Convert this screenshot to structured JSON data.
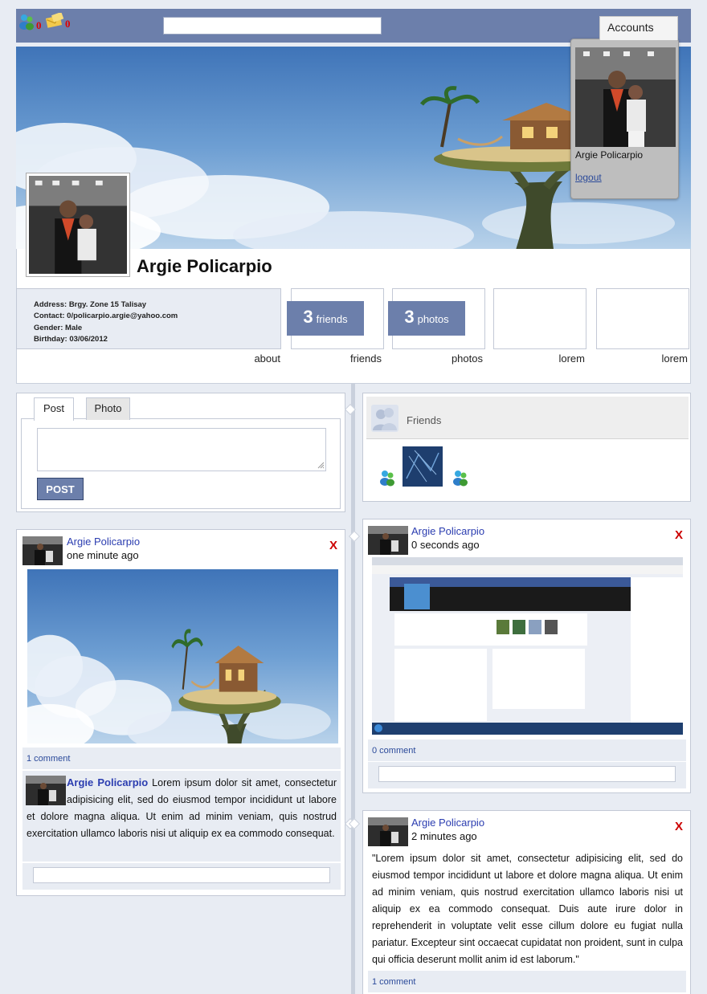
{
  "topbar": {
    "friend_requests_count": "0",
    "messages_count": "0",
    "search_value": ""
  },
  "accounts": {
    "tab_label": "Accounts",
    "user_name": "Argie Policarpio",
    "logout_label": "logout"
  },
  "profile": {
    "name": "Argie Policarpio",
    "address": "Address: Brgy. Zone 15 Talisay",
    "contact": "Contact: 0/policarpio.argie@yahoo.com",
    "gender": "Gender: Male",
    "birthday": "Birthday: 03/06/2012",
    "friends_count": "3",
    "friends_word": "friends",
    "photos_count": "3",
    "photos_word": "photos",
    "tab_labels": [
      "about",
      "friends",
      "photos",
      "lorem",
      "lorem"
    ]
  },
  "composer": {
    "tab_post": "Post",
    "tab_photo": "Photo",
    "post_button": "POST",
    "textarea_value": ""
  },
  "friends_widget": {
    "title": "Friends"
  },
  "feed": {
    "left_post": {
      "author": "Argie Policarpio",
      "time": "one minute ago",
      "delete_label": "X",
      "comment_count": "1 comment",
      "comment": {
        "author": "Argie Policarpio",
        "text": " Lorem ipsum dolor sit amet, consectetur adipisicing elit, sed do eiusmod tempor incididunt ut labore et dolore magna aliqua. Ut enim ad minim veniam, quis nostrud exercitation ullamco laboris nisi ut aliquip ex ea commodo consequat."
      }
    },
    "right_post_1": {
      "author": "Argie Policarpio",
      "time": "0 seconds ago",
      "delete_label": "X",
      "comment_count": "0 comment"
    },
    "right_post_2": {
      "author": "Argie Policarpio",
      "time": "2 minutes ago",
      "delete_label": "X",
      "text": "\"Lorem ipsum dolor sit amet, consectetur adipisicing elit, sed do eiusmod tempor incididunt ut labore et dolore magna aliqua. Ut enim ad minim veniam, quis nostrud exercitation ullamco laboris nisi ut aliquip ex ea commodo consequat. Duis aute irure dolor in reprehenderit in voluptate velit esse cillum dolore eu fugiat nulla pariatur. Excepteur sint occaecat cupidatat non proident, sunt in culpa qui officia deserunt mollit anim id est laborum.\"",
      "comment_count": "1 comment"
    }
  },
  "colors": {
    "brand": "#6c7fab",
    "link": "#2b3db0",
    "delete": "#cc0000",
    "page_bg": "#e8ecf3"
  },
  "icons": [
    "friends-icon",
    "messages-icon",
    "resize-grip-icon",
    "friends-silhouette-icon",
    "messenger-user-icon"
  ]
}
